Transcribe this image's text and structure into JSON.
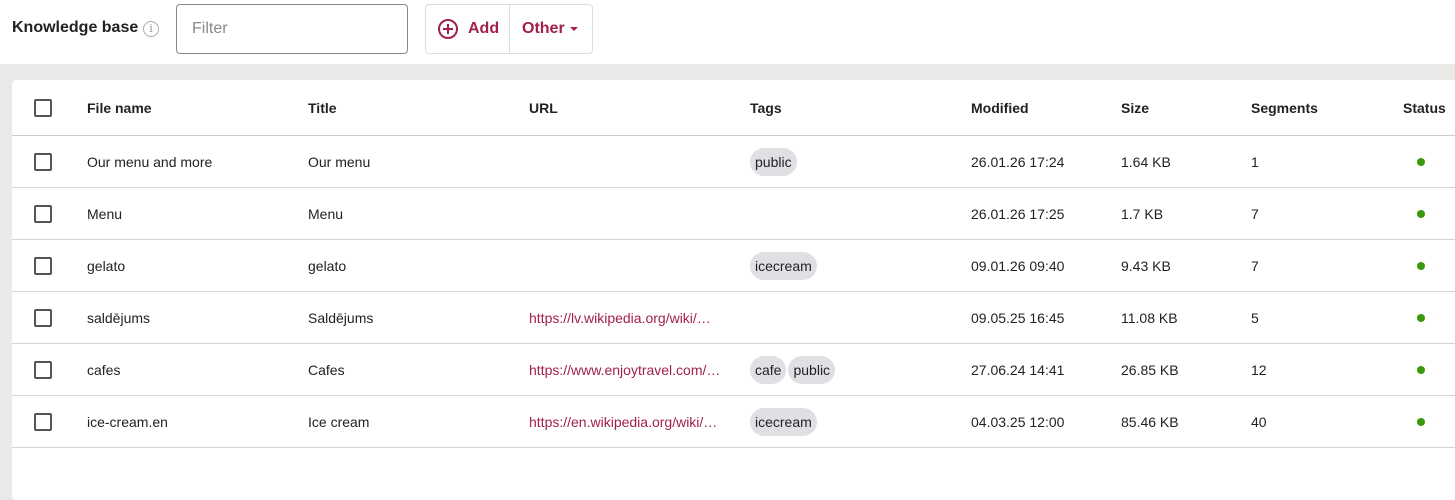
{
  "header": {
    "title": "Knowledge base",
    "filter_placeholder": "Filter",
    "add_label": "Add",
    "other_label": "Other"
  },
  "colors": {
    "accent": "#a1214b",
    "status_ok": "#3a9a0a"
  },
  "table": {
    "columns": [
      "File name",
      "Title",
      "URL",
      "Tags",
      "Modified",
      "Size",
      "Segments",
      "Status"
    ],
    "rows": [
      {
        "file": "Our menu and more",
        "title": "Our menu",
        "url": "",
        "tags": [
          "public"
        ],
        "modified": "26.01.26 17:24",
        "size": "1.64 KB",
        "segments": "1",
        "status": "ok"
      },
      {
        "file": "Menu",
        "title": "Menu",
        "url": "",
        "tags": [],
        "modified": "26.01.26 17:25",
        "size": "1.7 KB",
        "segments": "7",
        "status": "ok"
      },
      {
        "file": "gelato",
        "title": "gelato",
        "url": "",
        "tags": [
          "icecream"
        ],
        "modified": "09.01.26 09:40",
        "size": "9.43 KB",
        "segments": "7",
        "status": "ok"
      },
      {
        "file": "saldējums",
        "title": "Saldējums",
        "url": "https://lv.wikipedia.org/wiki/…",
        "tags": [],
        "modified": "09.05.25 16:45",
        "size": "11.08 KB",
        "segments": "5",
        "status": "ok"
      },
      {
        "file": "cafes",
        "title": "Cafes",
        "url": "https://www.enjoytravel.com/…",
        "tags": [
          "cafe",
          "public"
        ],
        "modified": "27.06.24 14:41",
        "size": "26.85 KB",
        "segments": "12",
        "status": "ok"
      },
      {
        "file": "ice-cream.en",
        "title": "Ice cream",
        "url": "https://en.wikipedia.org/wiki/…",
        "tags": [
          "icecream"
        ],
        "modified": "04.03.25 12:00",
        "size": "85.46 KB",
        "segments": "40",
        "status": "ok"
      }
    ]
  }
}
